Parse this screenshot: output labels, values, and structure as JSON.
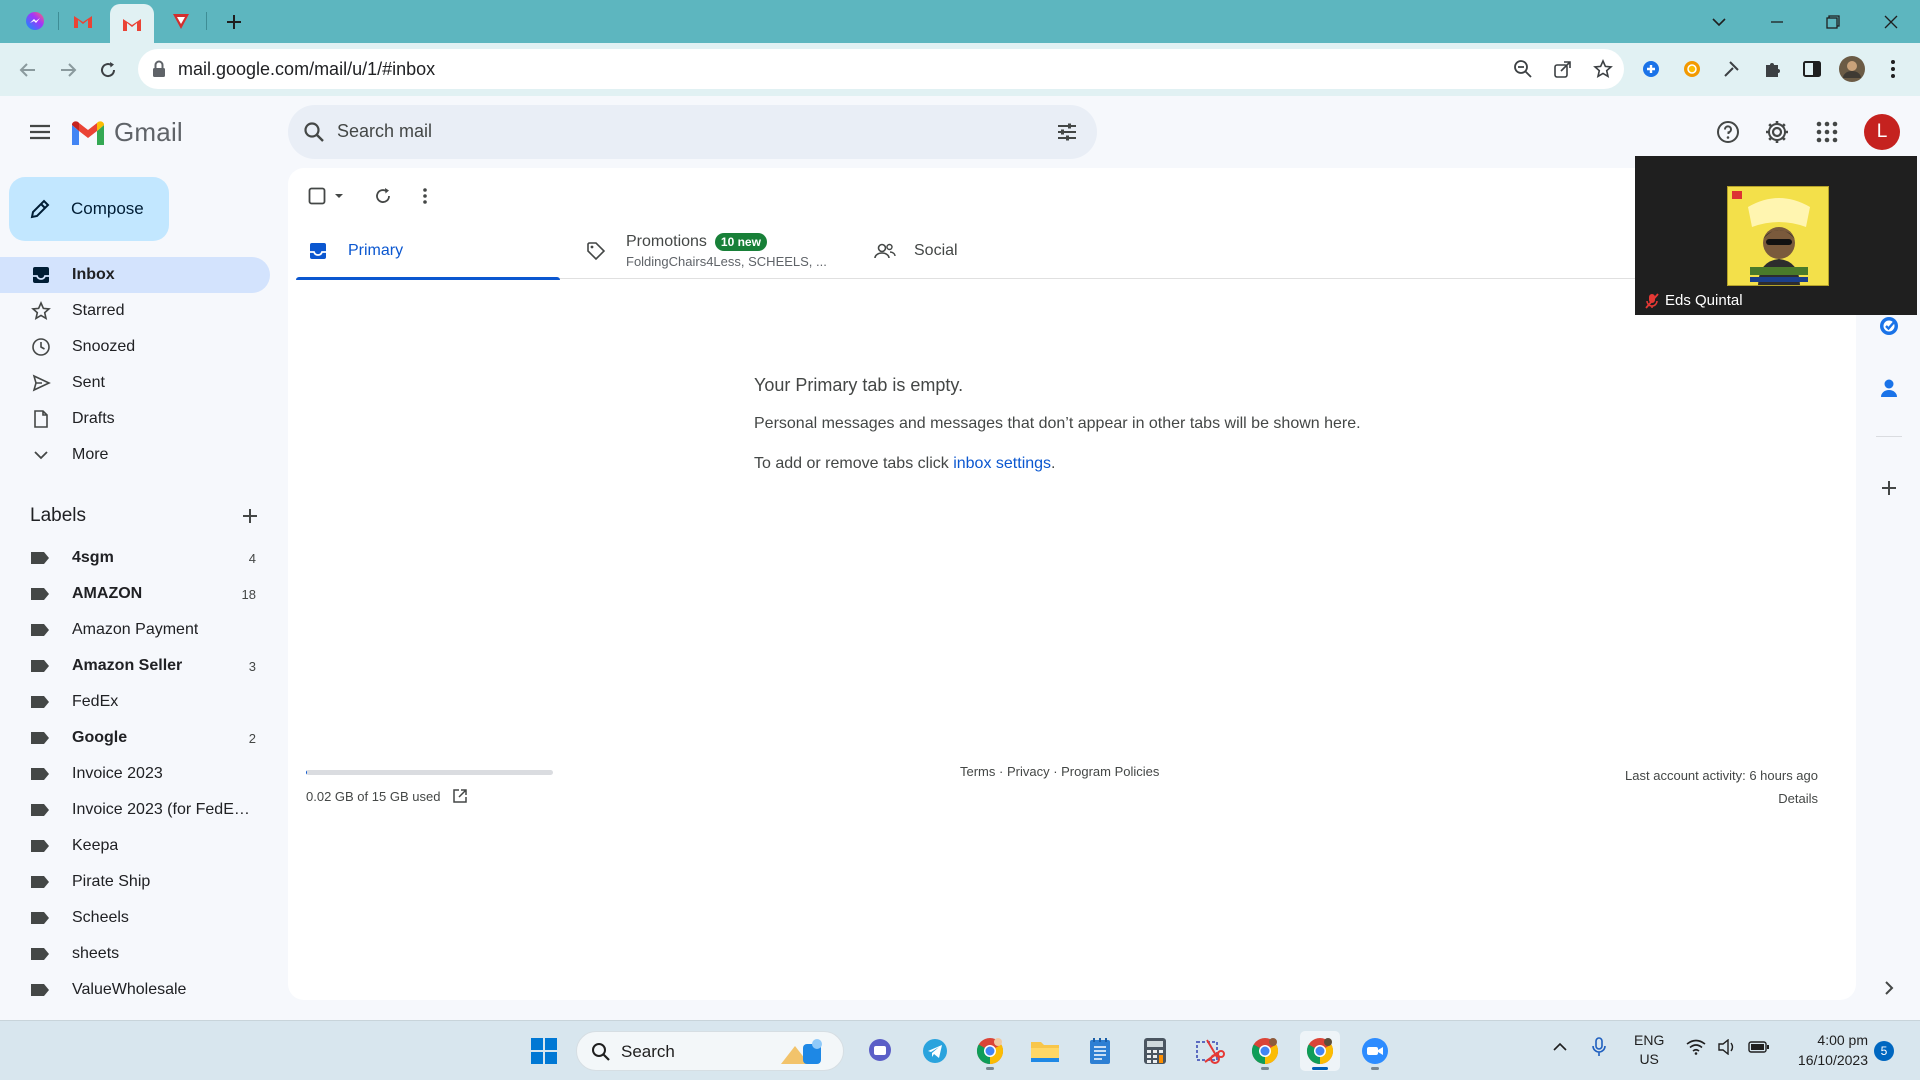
{
  "browser": {
    "url": "mail.google.com/mail/u/1/#inbox"
  },
  "gmail": {
    "app_name": "Gmail",
    "search_placeholder": "Search mail",
    "avatar_letter": "L",
    "compose_label": "Compose",
    "nav": [
      {
        "label": "Inbox",
        "icon": "inbox-icon"
      },
      {
        "label": "Starred",
        "icon": "star-icon"
      },
      {
        "label": "Snoozed",
        "icon": "clock-icon"
      },
      {
        "label": "Sent",
        "icon": "send-icon"
      },
      {
        "label": "Drafts",
        "icon": "draft-icon"
      },
      {
        "label": "More",
        "icon": "chevron-down-icon"
      }
    ],
    "labels_title": "Labels",
    "labels": [
      {
        "name": "4sgm",
        "count": "4"
      },
      {
        "name": "AMAZON",
        "count": "18"
      },
      {
        "name": "Amazon Payment",
        "count": ""
      },
      {
        "name": "Amazon Seller",
        "count": "3"
      },
      {
        "name": "FedEx",
        "count": ""
      },
      {
        "name": "Google",
        "count": "2"
      },
      {
        "name": "Invoice 2023",
        "count": ""
      },
      {
        "name": "Invoice 2023 (for FedEx ...",
        "count": ""
      },
      {
        "name": "Keepa",
        "count": ""
      },
      {
        "name": "Pirate Ship",
        "count": ""
      },
      {
        "name": "Scheels",
        "count": ""
      },
      {
        "name": "sheets",
        "count": ""
      },
      {
        "name": "ValueWholesale",
        "count": ""
      }
    ],
    "tabs": {
      "primary": "Primary",
      "promotions": "Promotions",
      "promotions_badge": "10 new",
      "promotions_senders": "FoldingChairs4Less, SCHEELS, ...",
      "social": "Social"
    },
    "empty": {
      "title": "Your Primary tab is empty.",
      "line1": "Personal messages and messages that don’t appear in other tabs will be shown here.",
      "line2_prefix": "To add or remove tabs click ",
      "line2_link": "inbox settings",
      "line2_suffix": "."
    },
    "footer": {
      "storage": "0.02 GB of 15 GB used",
      "storage_fraction": 0.0013,
      "terms": "Terms",
      "privacy": "Privacy",
      "policies": "Program Policies",
      "separator": " · ",
      "last_activity": "Last account activity: 6 hours ago",
      "details": "Details"
    }
  },
  "zoom": {
    "participant": "Eds Quintal"
  },
  "taskbar": {
    "search": "Search",
    "lang_top": "ENG",
    "lang_bottom": "US",
    "time": "4:00 pm",
    "date": "16/10/2023",
    "notifications": "5"
  },
  "colors": {
    "accent": "#0b57d0",
    "tabstrip": "#5db6bf",
    "badge": "#188038",
    "avatar": "#c5221f"
  }
}
